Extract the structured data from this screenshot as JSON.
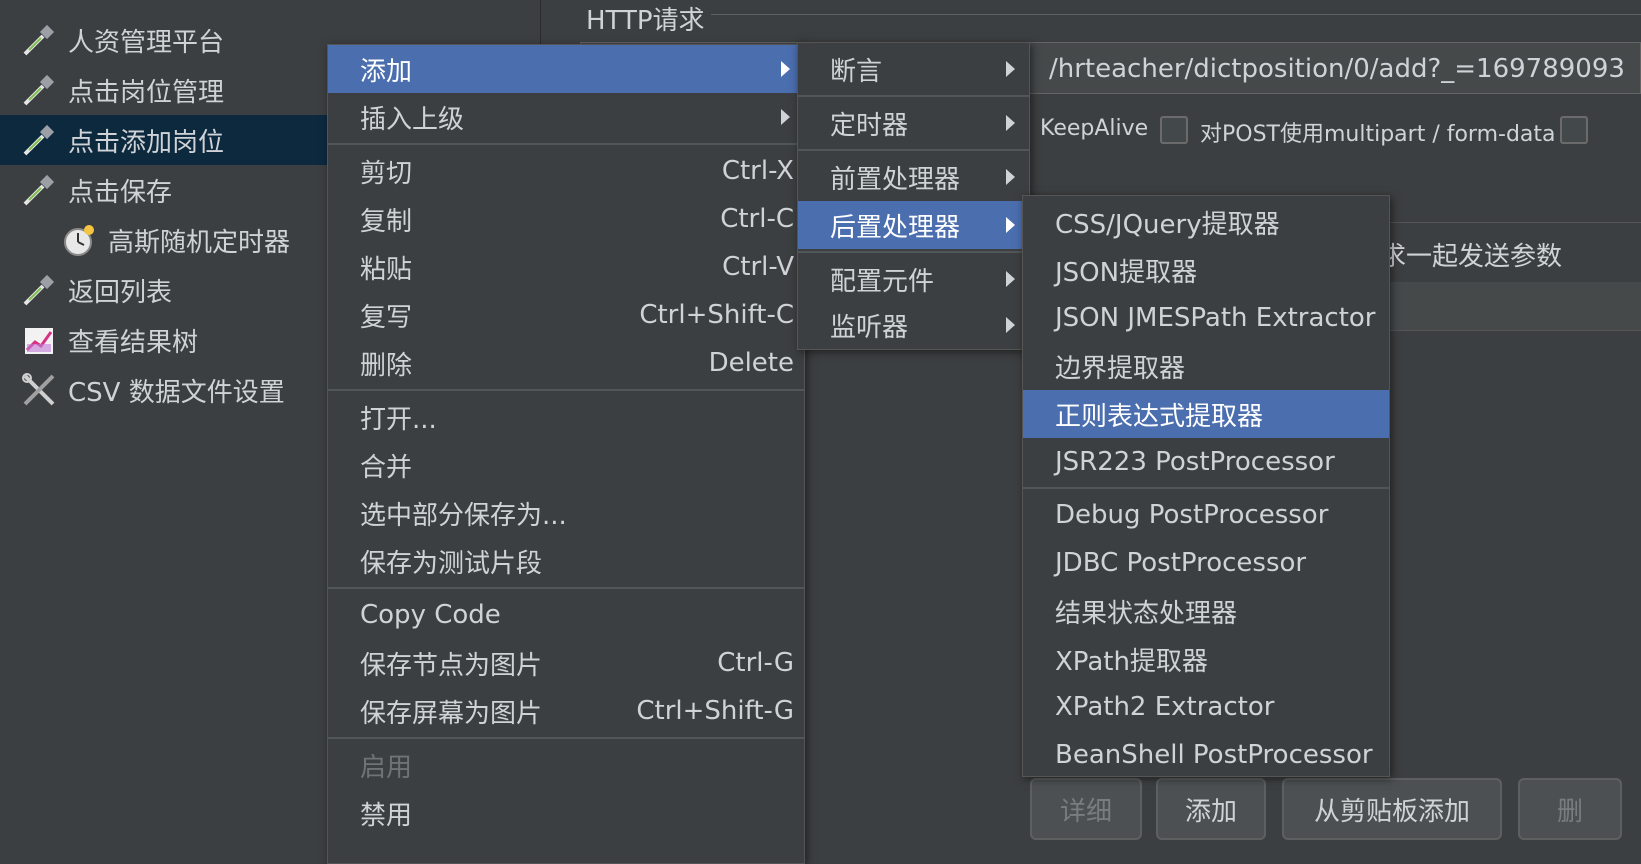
{
  "tree": {
    "items": [
      {
        "label": "人资管理平台",
        "icon": "pipette-icon"
      },
      {
        "label": "点击岗位管理",
        "icon": "pipette-icon"
      },
      {
        "label": "点击添加岗位",
        "icon": "pipette-icon",
        "selected": true
      },
      {
        "label": "点击保存",
        "icon": "pipette-icon"
      },
      {
        "label": "高斯随机定时器",
        "icon": "stopwatch-icon"
      },
      {
        "label": "返回列表",
        "icon": "pipette-icon"
      },
      {
        "label": "查看结果树",
        "icon": "chart-icon"
      },
      {
        "label": "CSV 数据文件设置",
        "icon": "tools-icon"
      }
    ]
  },
  "panel": {
    "section_title": "HTTP请求",
    "path_value": "/hrteacher/dictposition/0/add?_=169789093",
    "keepalive_label": "KeepAlive",
    "multipart_label": "对POST使用multipart / form-data",
    "send_params_label": "求一起发送参数",
    "buttons": {
      "detail": "详细",
      "add": "添加",
      "add_from_clipboard": "从剪贴板添加",
      "delete": "删"
    }
  },
  "context_menu": {
    "items": [
      {
        "label": "添加",
        "submenu": true,
        "highlight": true
      },
      {
        "label": "插入上级",
        "submenu": true
      },
      {
        "label": "剪切",
        "shortcut": "Ctrl-X"
      },
      {
        "label": "复制",
        "shortcut": "Ctrl-C"
      },
      {
        "label": "粘贴",
        "shortcut": "Ctrl-V"
      },
      {
        "label": "复写",
        "shortcut": "Ctrl+Shift-C"
      },
      {
        "label": "删除",
        "shortcut": "Delete"
      },
      {
        "label": "打开..."
      },
      {
        "label": "合并"
      },
      {
        "label": "选中部分保存为..."
      },
      {
        "label": "保存为测试片段"
      },
      {
        "label": "Copy Code"
      },
      {
        "label": "保存节点为图片",
        "shortcut": "Ctrl-G"
      },
      {
        "label": "保存屏幕为图片",
        "shortcut": "Ctrl+Shift-G"
      },
      {
        "label": "启用",
        "disabled": true
      },
      {
        "label": "禁用"
      }
    ]
  },
  "add_submenu": {
    "items": [
      {
        "label": "断言"
      },
      {
        "label": "定时器"
      },
      {
        "label": "前置处理器"
      },
      {
        "label": "后置处理器",
        "highlight": true
      },
      {
        "label": "配置元件"
      },
      {
        "label": "监听器"
      }
    ]
  },
  "postprocessor_submenu": {
    "items": [
      {
        "label": "CSS/JQuery提取器"
      },
      {
        "label": "JSON提取器"
      },
      {
        "label": "JSON JMESPath Extractor"
      },
      {
        "label": "边界提取器"
      },
      {
        "label": "正则表达式提取器",
        "highlight": true
      },
      {
        "label": "JSR223 PostProcessor"
      },
      {
        "label": "Debug PostProcessor"
      },
      {
        "label": "JDBC PostProcessor"
      },
      {
        "label": "结果状态处理器"
      },
      {
        "label": "XPath提取器"
      },
      {
        "label": "XPath2 Extractor"
      },
      {
        "label": "BeanShell PostProcessor"
      }
    ]
  },
  "colors": {
    "highlight": "#4b6eaf",
    "background": "#3c3f41",
    "text": "#cfd3d7",
    "tree_selected": "#0d293e"
  }
}
